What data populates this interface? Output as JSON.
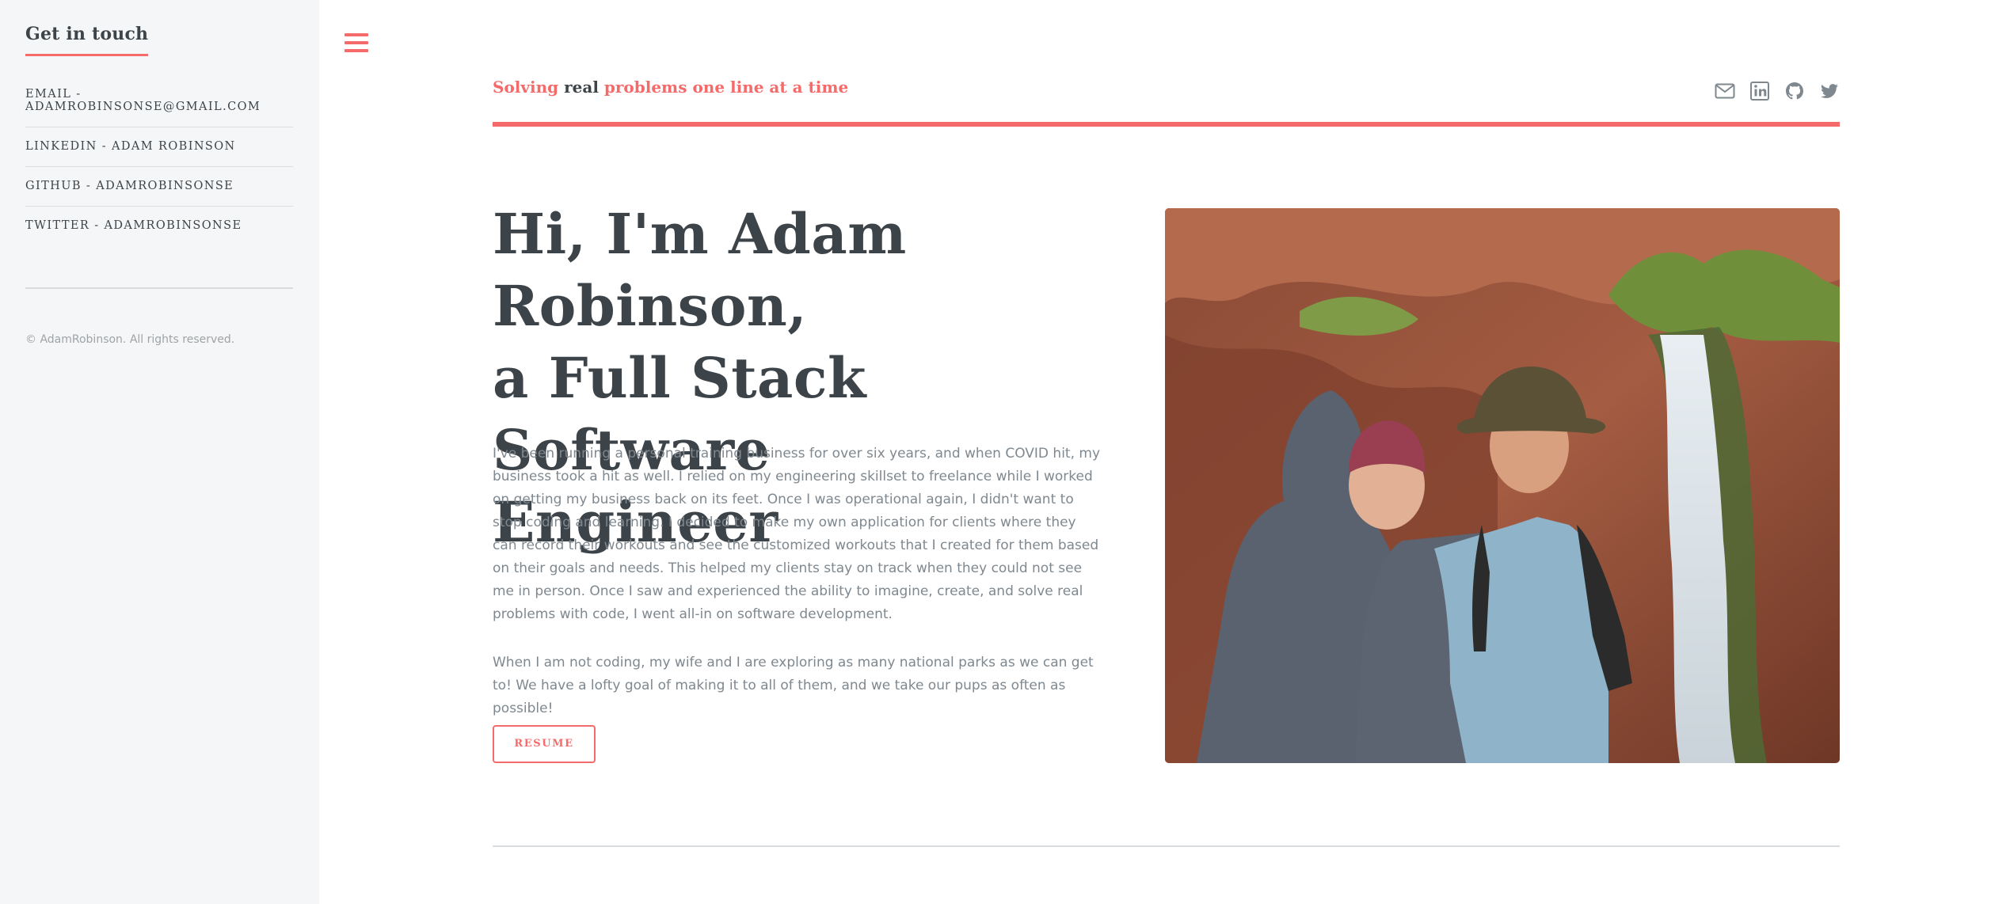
{
  "sidebar": {
    "title": "Get in touch",
    "contacts": [
      "EMAIL - ADAMROBINSONSE@GMAIL.COM",
      "LINKEDIN - ADAM ROBINSON",
      "GITHUB - ADAMROBINSONSE",
      "TWITTER - ADAMROBINSONSE"
    ],
    "copyright": "© AdamRobinson. All rights reserved."
  },
  "header": {
    "logo_part1": "Solving",
    "logo_part2": "real",
    "logo_part3": "problems one line at a time",
    "icons": [
      "envelope-icon",
      "linkedin-icon",
      "github-icon",
      "twitter-icon"
    ]
  },
  "hero": {
    "title_line1": "Hi, I'm Adam Robinson,",
    "title_line2": "a Full Stack Software",
    "title_line3": "Engineer",
    "paragraph1": "I've been running a personal training business for over six years, and when COVID hit, my business took a hit as well. I relied on my engineering skillset to freelance while I worked on getting my business back on its feet. Once I was operational again, I didn't want to stop coding and learning. I decided to make my own application for clients where they can record their workouts and see the customized workouts that I created for them based on their goals and needs. This helped my clients stay on track when they could not see me in person. Once I saw and experienced the ability to imagine, create, and solve real problems with code, I went all-in on software development.",
    "paragraph2": "When I am not coding, my wife and I are exploring as many national parks as we can get to! We have a lofty goal of making it to all of them, and we take our pups as often as possible!",
    "resume_label": "RESUME"
  },
  "colors": {
    "accent": "#f56a6a",
    "text": "#3d4449",
    "muted": "#7f888f",
    "sidebar_bg": "#f5f6f7"
  }
}
